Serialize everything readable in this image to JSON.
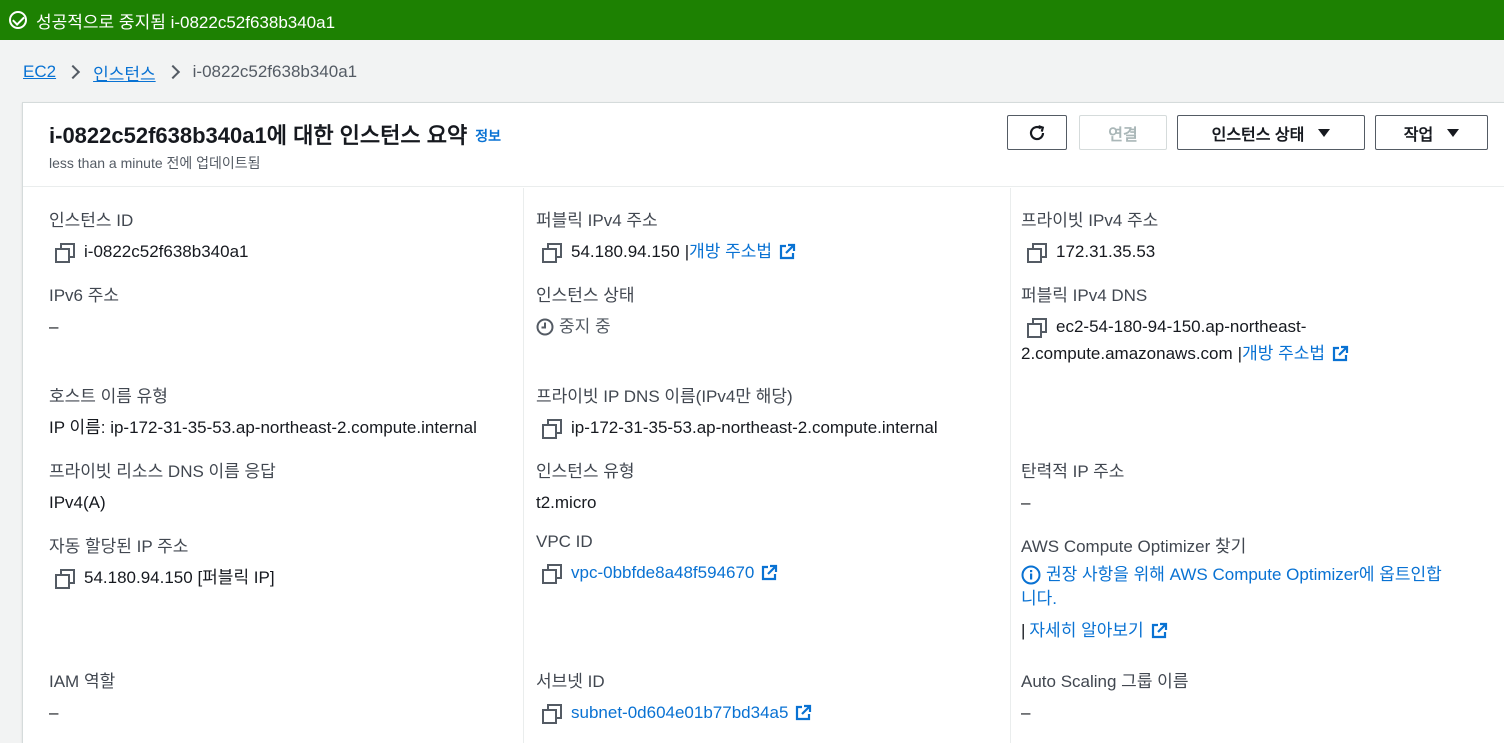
{
  "flash": {
    "message": "성공적으로 중지됨 i-0822c52f638b340a1"
  },
  "breadcrumb": {
    "ec2": "EC2",
    "instances": "인스턴스",
    "current": "i-0822c52f638b340a1"
  },
  "header": {
    "title": "i-0822c52f638b340a1에 대한 인스턴스 요약",
    "info": "정보",
    "updated": "less than a minute 전에 업데이트됨",
    "connect": "연결",
    "instance_state": "인스턴스 상태",
    "actions": "작업"
  },
  "fields": {
    "instance_id": {
      "label": "인스턴스 ID",
      "value": "i-0822c52f638b340a1"
    },
    "public_ipv4": {
      "label": "퍼블릭 IPv4 주소",
      "value": "54.180.94.150",
      "sep": "|",
      "link": "개방 주소법"
    },
    "private_ipv4": {
      "label": "프라이빗 IPv4 주소",
      "value": "172.31.35.53"
    },
    "ipv6": {
      "label": "IPv6 주소",
      "value": "–"
    },
    "instance_state": {
      "label": "인스턴스 상태",
      "value": "중지 중"
    },
    "public_dns": {
      "label": "퍼블릭 IPv4 DNS",
      "value_line1": "ec2-54-180-94-150.ap-northeast-",
      "value_line2": "2.compute.amazonaws.com",
      "sep": "|",
      "link": "개방 주소법"
    },
    "hostname_type": {
      "label": "호스트 이름 유형",
      "value": "IP 이름: ip-172-31-35-53.ap-northeast-2.compute.internal"
    },
    "private_dns": {
      "label": "프라이빗 IP DNS 이름(IPv4만 해당)",
      "value": "ip-172-31-35-53.ap-northeast-2.compute.internal"
    },
    "resource_dns": {
      "label": "프라이빗 리소스 DNS 이름 응답",
      "value": "IPv4(A)"
    },
    "instance_type": {
      "label": "인스턴스 유형",
      "value": "t2.micro"
    },
    "elastic_ip": {
      "label": "탄력적 IP 주소",
      "value": "–"
    },
    "auto_ip": {
      "label": "자동 할당된 IP 주소",
      "value": "54.180.94.150 [퍼블릭 IP]"
    },
    "vpc_id": {
      "label": "VPC ID",
      "value": "vpc-0bbfde8a48f594670"
    },
    "optimizer": {
      "label": "AWS Compute Optimizer 찾기",
      "line1": "권장 사항을 위해 AWS Compute Optimizer에 옵트인합",
      "line2": "니다.",
      "sep": "|",
      "learn_more": "자세히 알아보기"
    },
    "iam_role": {
      "label": "IAM 역할",
      "value": "–"
    },
    "subnet_id": {
      "label": "서브넷 ID",
      "value": "subnet-0d604e01b77bd34a5"
    },
    "asg_name": {
      "label": "Auto Scaling 그룹 이름",
      "value": "–"
    }
  },
  "colors": {
    "success": "#1d8102",
    "link": "#0972d3",
    "text": "#16191f"
  }
}
